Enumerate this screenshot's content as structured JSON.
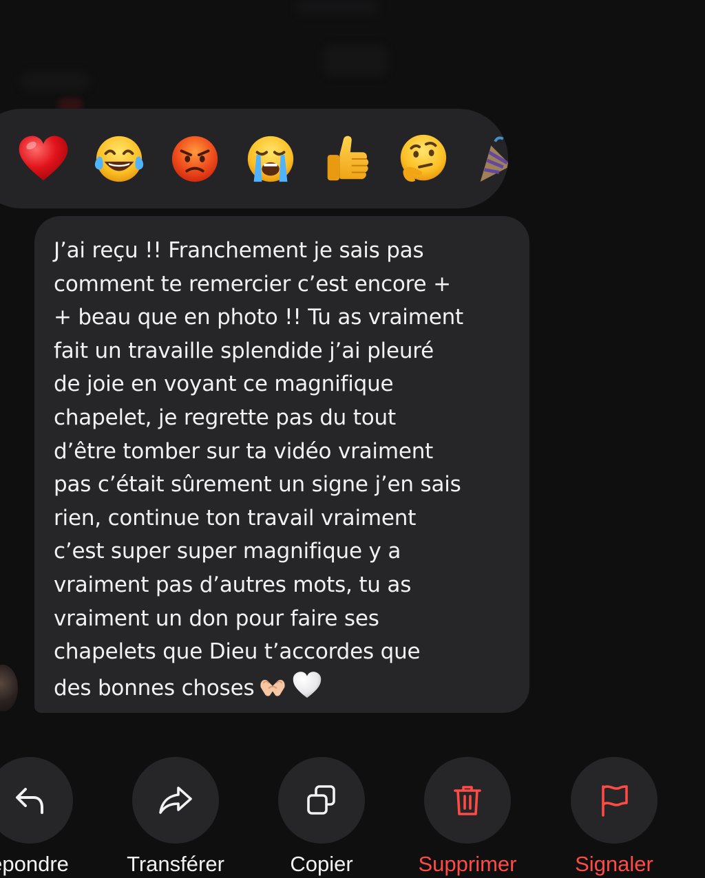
{
  "reactions": [
    {
      "icon": "red-heart-emoji"
    },
    {
      "icon": "tears-of-joy-emoji"
    },
    {
      "icon": "angry-face-emoji"
    },
    {
      "icon": "loudly-crying-face-emoji"
    },
    {
      "icon": "thumbs-up-emoji"
    },
    {
      "icon": "thinking-face-emoji"
    },
    {
      "icon": "party-popper-emoji"
    }
  ],
  "message": {
    "text": "J’ai reçu !! Franchement je sais pas\ncomment te remercier c’est encore +\n+ beau que en photo !! Tu as vraiment\nfait un travaille splendide j’ai pleuré\nde joie en voyant ce magnifique\nchapelet, je regrette pas du tout\nd’être tomber sur ta vidéo vraiment\npas c’était sûrement un signe j’en sais\nrien, continue ton travail vraiment\nc’est super super magnifique y a\nvraiment pas d’autres mots, tu as\nvraiment un don pour faire ses\nchapelets que Dieu t’accordes que\ndes bonnes choses",
    "trailing_emojis": [
      "heart-hands-emoji",
      "white-heart-emoji"
    ]
  },
  "actions": {
    "reply_label": "épondre",
    "forward_label": "Transférer",
    "copy_label": "Copier",
    "delete_label": "Supprimer",
    "report_label": "Signaler"
  },
  "colors": {
    "background": "#0f0f10",
    "surface": "#262628",
    "text": "#f2f2f2",
    "danger": "#ff4a45"
  }
}
